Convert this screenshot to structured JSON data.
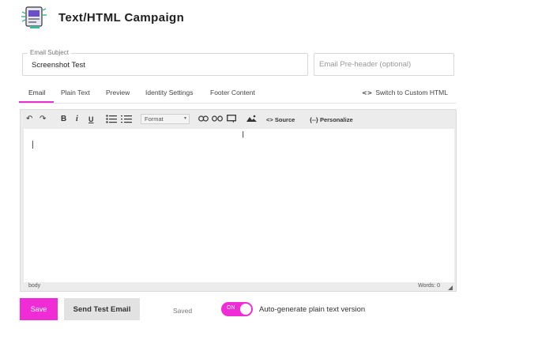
{
  "header": {
    "title": "Text/HTML Campaign",
    "logo_icon": "campaign-illustration-icon"
  },
  "fields": {
    "subject_label": "Email Subject",
    "subject_value": "Screenshot Test",
    "preheader_placeholder": "Email Pre-header (optional)"
  },
  "tabs": [
    {
      "label": "Email",
      "active": true
    },
    {
      "label": "Plain Text"
    },
    {
      "label": "Preview"
    },
    {
      "label": "Identity Settings"
    },
    {
      "label": "Footer Content"
    }
  ],
  "switch_html": {
    "icon": "<>",
    "label": "Switch to Custom HTML"
  },
  "toolbar": {
    "undo": "↶",
    "redo": "↷",
    "bold": "B",
    "italic": "i",
    "underline": "U",
    "format": "Format",
    "source_label": "Source",
    "personalize_label": "Personalize",
    "personalize_icon": "{--}"
  },
  "editor": {
    "path": "body",
    "words": "Words: 0"
  },
  "footer": {
    "save_label": "Save",
    "send_test_label": "Send Test Email",
    "saved_text": "Saved",
    "toggle_state": "ON",
    "toggle_label": "Auto-generate plain text version"
  },
  "colors": {
    "accent": "#ef2cd6",
    "toolbar_bg": "#ececec"
  }
}
